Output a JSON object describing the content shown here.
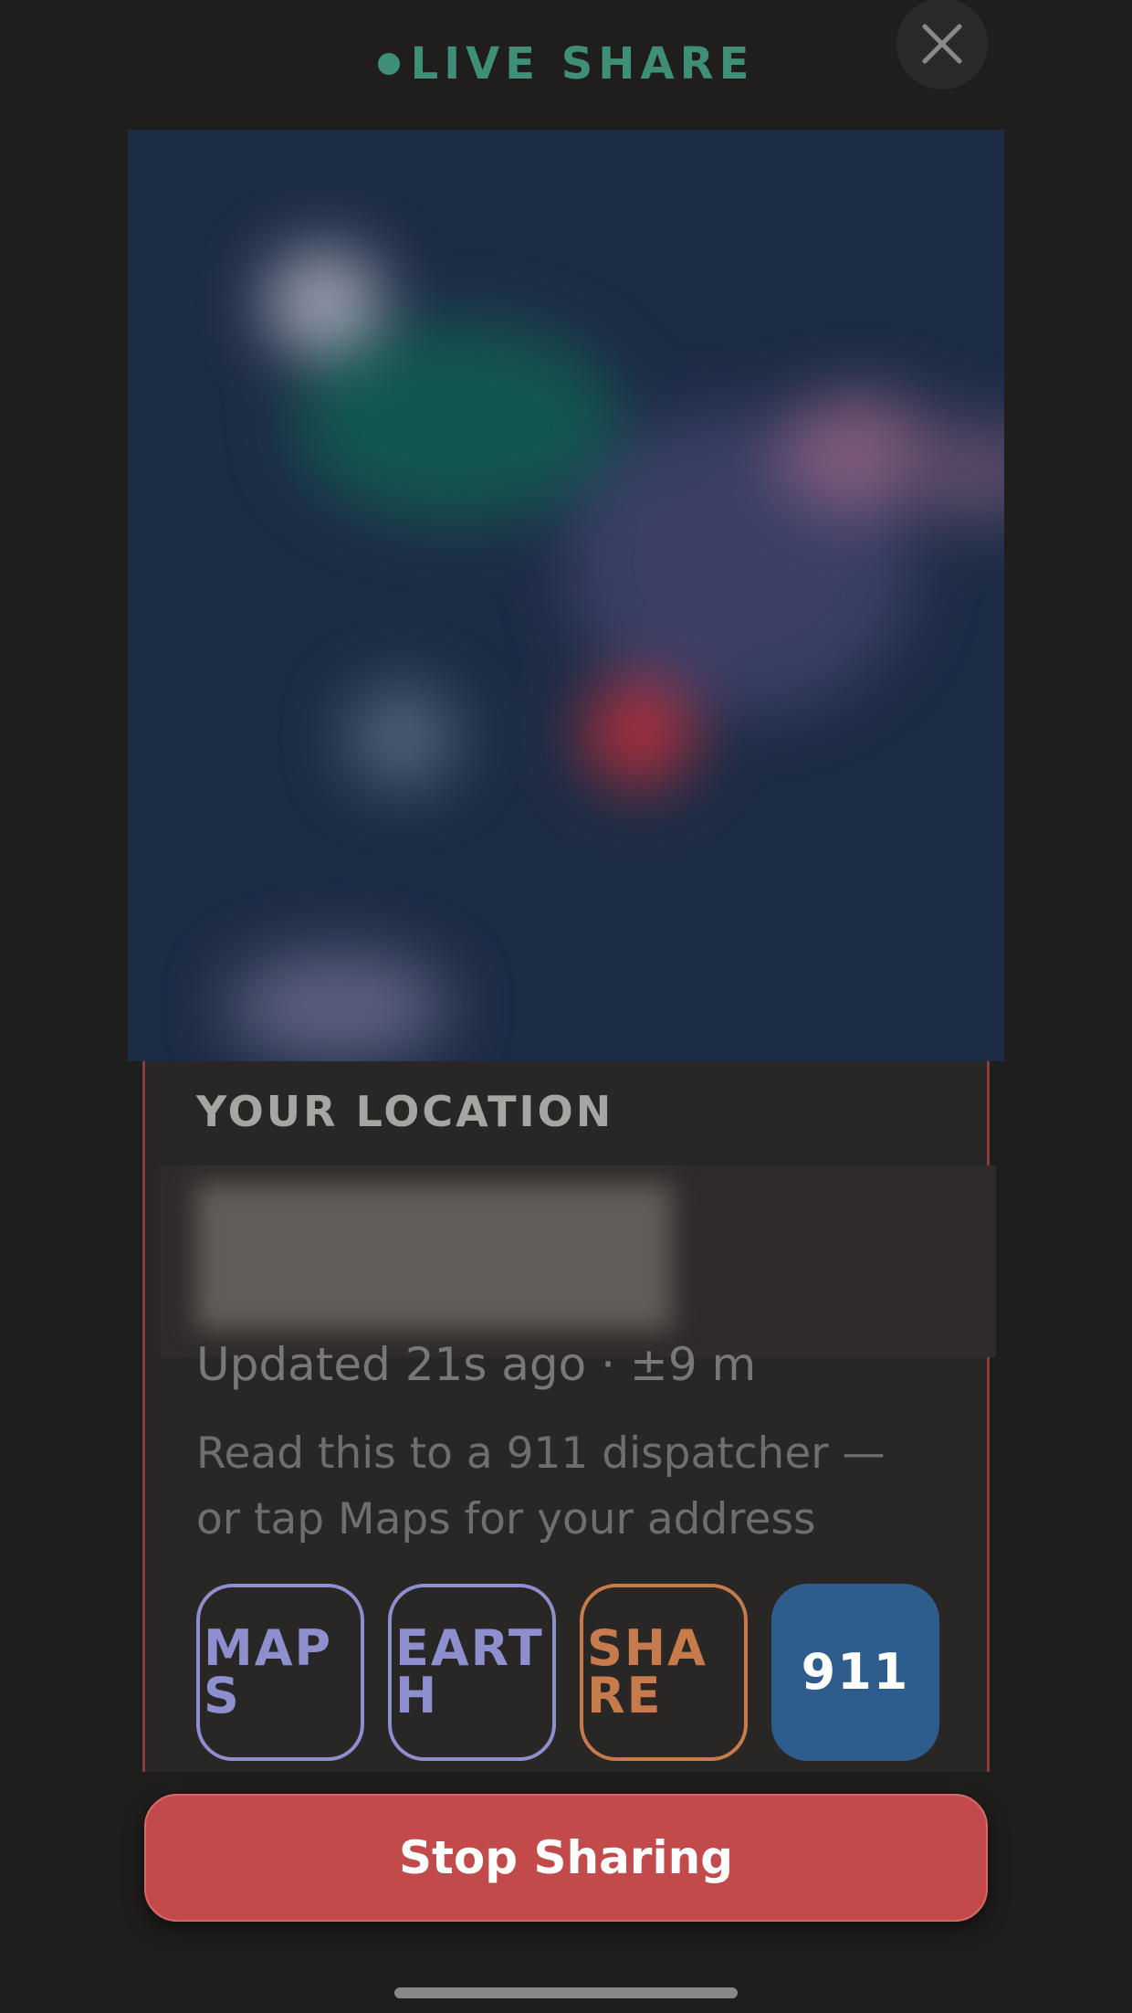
{
  "header": {
    "title": "LIVE SHARE",
    "accent_color": "#3f8f78",
    "close_icon": "close-icon"
  },
  "location_card": {
    "label": "YOUR LOCATION",
    "updated_text": "Updated 21s ago · ±9 m",
    "hint_line1": "Read this to a 911 dispatcher —",
    "hint_line2": "or tap Maps for your address"
  },
  "actions": {
    "maps": "MAPS",
    "earth": "EARTH",
    "share": "SHARE",
    "emergency": "911"
  },
  "footer": {
    "stop_label": "Stop Sharing"
  },
  "colors": {
    "background": "#1f1e1d",
    "stop_button": "#c34a4a",
    "emergency_button": "#2e5d8d",
    "maps_earth_outline": "#8e8fcf",
    "share_outline": "#c77a4b"
  }
}
